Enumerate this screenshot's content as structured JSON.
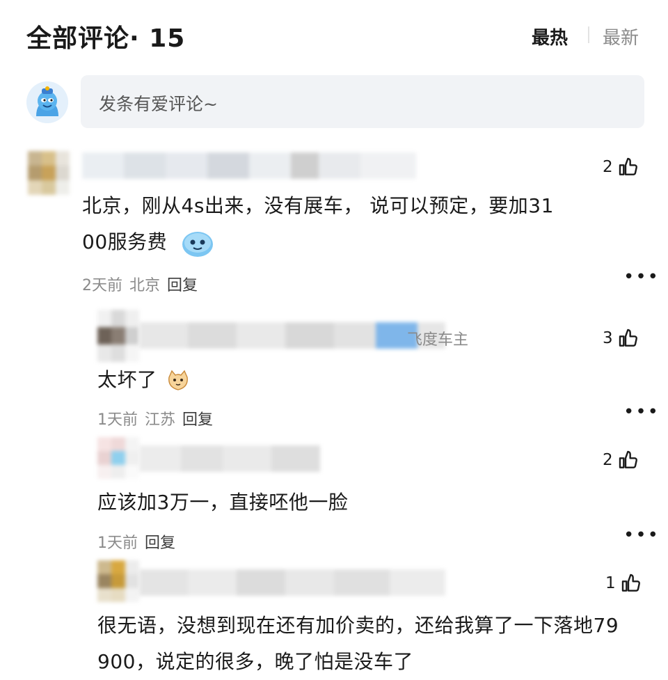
{
  "header": {
    "title": "全部评论· 15",
    "sort_hot": "最热",
    "sort_new": "最新"
  },
  "composer": {
    "placeholder": "发条有爱评论~"
  },
  "comments": [
    {
      "likes": "2",
      "text_line1": "北京，刚从4s出来，没有展车， 说可以预定，要加31",
      "text_line2": "00服务费",
      "time": "2天前",
      "location": "北京",
      "reply": "回复"
    }
  ],
  "replies": [
    {
      "badge": "飞度车主",
      "likes": "3",
      "text": "太坏了",
      "time": "1天前",
      "location": "江苏",
      "reply": "回复"
    },
    {
      "likes": "2",
      "text": "应该加3万一，直接呸他一脸",
      "time": "1天前",
      "reply": "回复"
    },
    {
      "likes": "1",
      "text_line1": "很无语，没想到现在还有加价卖的，还给我算了一下落地79",
      "text_line2": "900，说定的很多，晚了怕是没车了"
    }
  ],
  "icons": {
    "like": "thumbs-up-icon",
    "more": "more-dots-icon"
  }
}
